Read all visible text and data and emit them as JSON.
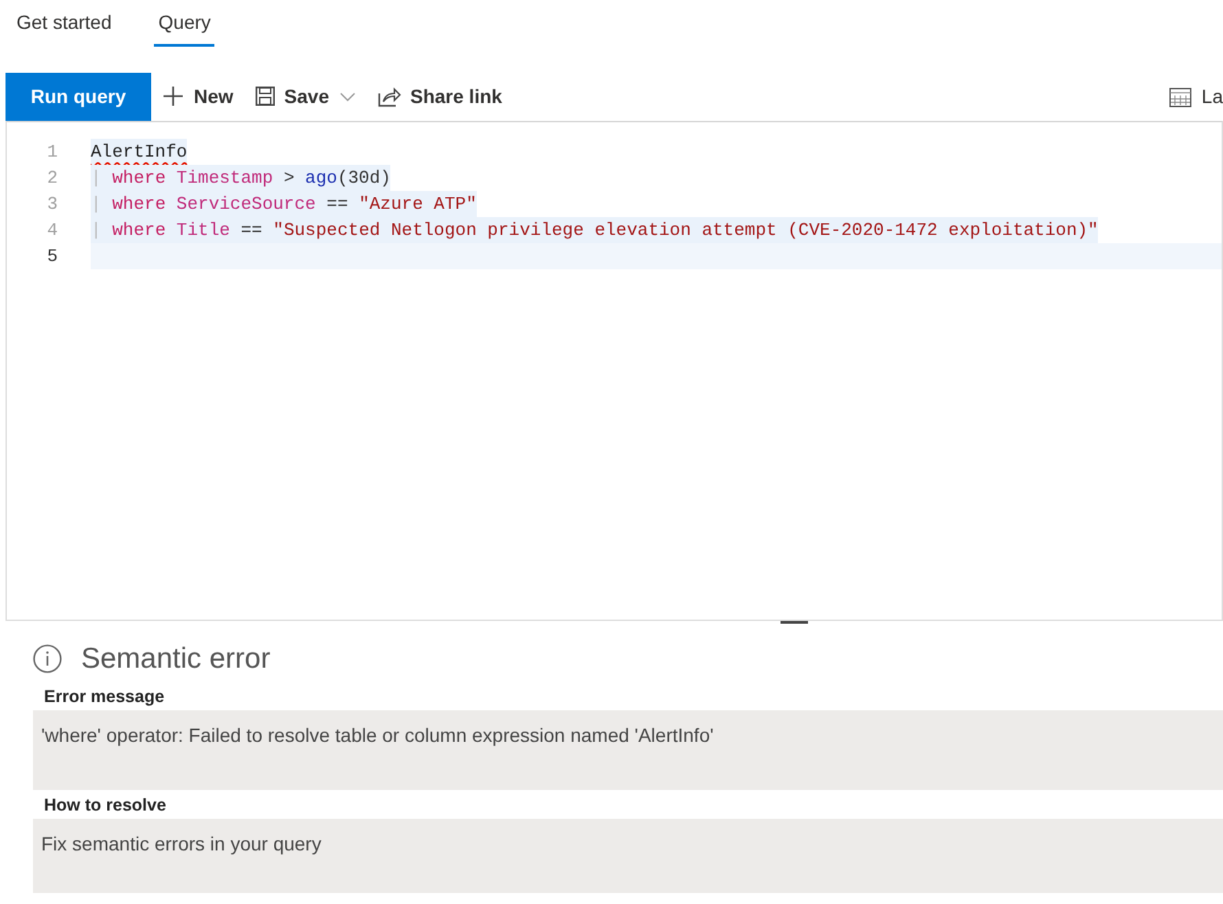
{
  "tabs": [
    {
      "label": "Get started",
      "selected": false
    },
    {
      "label": "Query",
      "selected": true
    }
  ],
  "toolbar": {
    "run_button": "Run query",
    "items": [
      {
        "kind": "new",
        "label": "New"
      },
      {
        "kind": "save",
        "label": "Save",
        "dropdown": true
      },
      {
        "kind": "share",
        "label": "Share link"
      }
    ],
    "right_item": {
      "kind": "calendar",
      "label": "La"
    }
  },
  "editor": {
    "lines": [
      {
        "number": "1",
        "selected": true,
        "current": false,
        "tokens": [
          {
            "kind": "error",
            "text": "AlertInfo"
          }
        ]
      },
      {
        "number": "2",
        "selected": true,
        "current": false,
        "tokens": [
          {
            "kind": "pipe",
            "text": "| "
          },
          {
            "kind": "keyword",
            "text": "where "
          },
          {
            "kind": "column",
            "text": "Timestamp"
          },
          {
            "kind": "plain",
            "text": " > "
          },
          {
            "kind": "function",
            "text": "ago"
          },
          {
            "kind": "plain",
            "text": "(30d)"
          }
        ]
      },
      {
        "number": "3",
        "selected": true,
        "current": false,
        "tokens": [
          {
            "kind": "pipe",
            "text": "| "
          },
          {
            "kind": "keyword",
            "text": "where "
          },
          {
            "kind": "column",
            "text": "ServiceSource"
          },
          {
            "kind": "plain",
            "text": " == "
          },
          {
            "kind": "string",
            "text": "\"Azure ATP\""
          }
        ]
      },
      {
        "number": "4",
        "selected": true,
        "current": false,
        "tokens": [
          {
            "kind": "pipe",
            "text": "| "
          },
          {
            "kind": "keyword",
            "text": "where "
          },
          {
            "kind": "column",
            "text": "Title"
          },
          {
            "kind": "plain",
            "text": " == "
          },
          {
            "kind": "string",
            "text": "\"Suspected Netlogon privilege elevation attempt (CVE-2020-1472 exploitation)\""
          }
        ]
      },
      {
        "number": "5",
        "selected": false,
        "current": true
      }
    ]
  },
  "error_panel": {
    "title": "Semantic error",
    "sections": [
      {
        "label": "Error message",
        "text": "'where' operator: Failed to resolve table or column expression named 'AlertInfo'"
      },
      {
        "label": "How to resolve",
        "text": "Fix semantic errors in your query"
      }
    ]
  }
}
